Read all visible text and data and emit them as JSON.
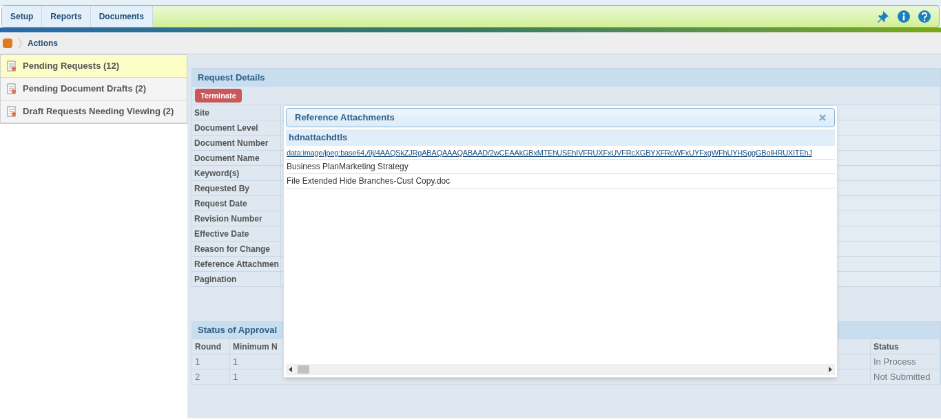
{
  "menu": {
    "tabs": [
      {
        "label": "Setup",
        "selected": false
      },
      {
        "label": "Reports",
        "selected": false
      },
      {
        "label": "Documents",
        "selected": false
      }
    ]
  },
  "breadcrumb": {
    "label": "Actions"
  },
  "sidebar": {
    "items": [
      {
        "label": "Pending Requests (12)",
        "selected": true
      },
      {
        "label": "Pending Document Drafts (2)",
        "selected": false
      },
      {
        "label": "Draft Requests Needing Viewing (2)",
        "selected": false
      }
    ]
  },
  "request_details": {
    "title": "Request Details",
    "button": "Terminate",
    "fields": [
      "Site",
      "Document Level",
      "Document Number",
      "Document Name",
      "Keyword(s)",
      "Requested By",
      "Request Date",
      "Revision Number",
      "Effective Date",
      "Reason for Change",
      "Reference Attachmen",
      "Pagination"
    ]
  },
  "status_of_approval": {
    "title": "Status of Approval",
    "columns": [
      "Round",
      "Minimum N",
      "Status"
    ],
    "rows": [
      [
        "1",
        "1",
        "In Process"
      ],
      [
        "2",
        "1",
        "Not Submitted"
      ]
    ]
  },
  "dialog": {
    "title": "Reference Attachments",
    "header": "hdnattachdtls",
    "link": "data:image/jpeg;base64,/9j/4AAQSkZJRgABAQAAAQABAAD/2wCEAAkGBxMTEhUSEhIVFRUXFxUVFRcXGBYXFRcWFxUYFxgWFhUYHSggGBolHRUXITEhJ",
    "items": [
      "Business PlanMarketing Strategy",
      "File Extended Hide Branches-Cust Copy.doc"
    ]
  }
}
